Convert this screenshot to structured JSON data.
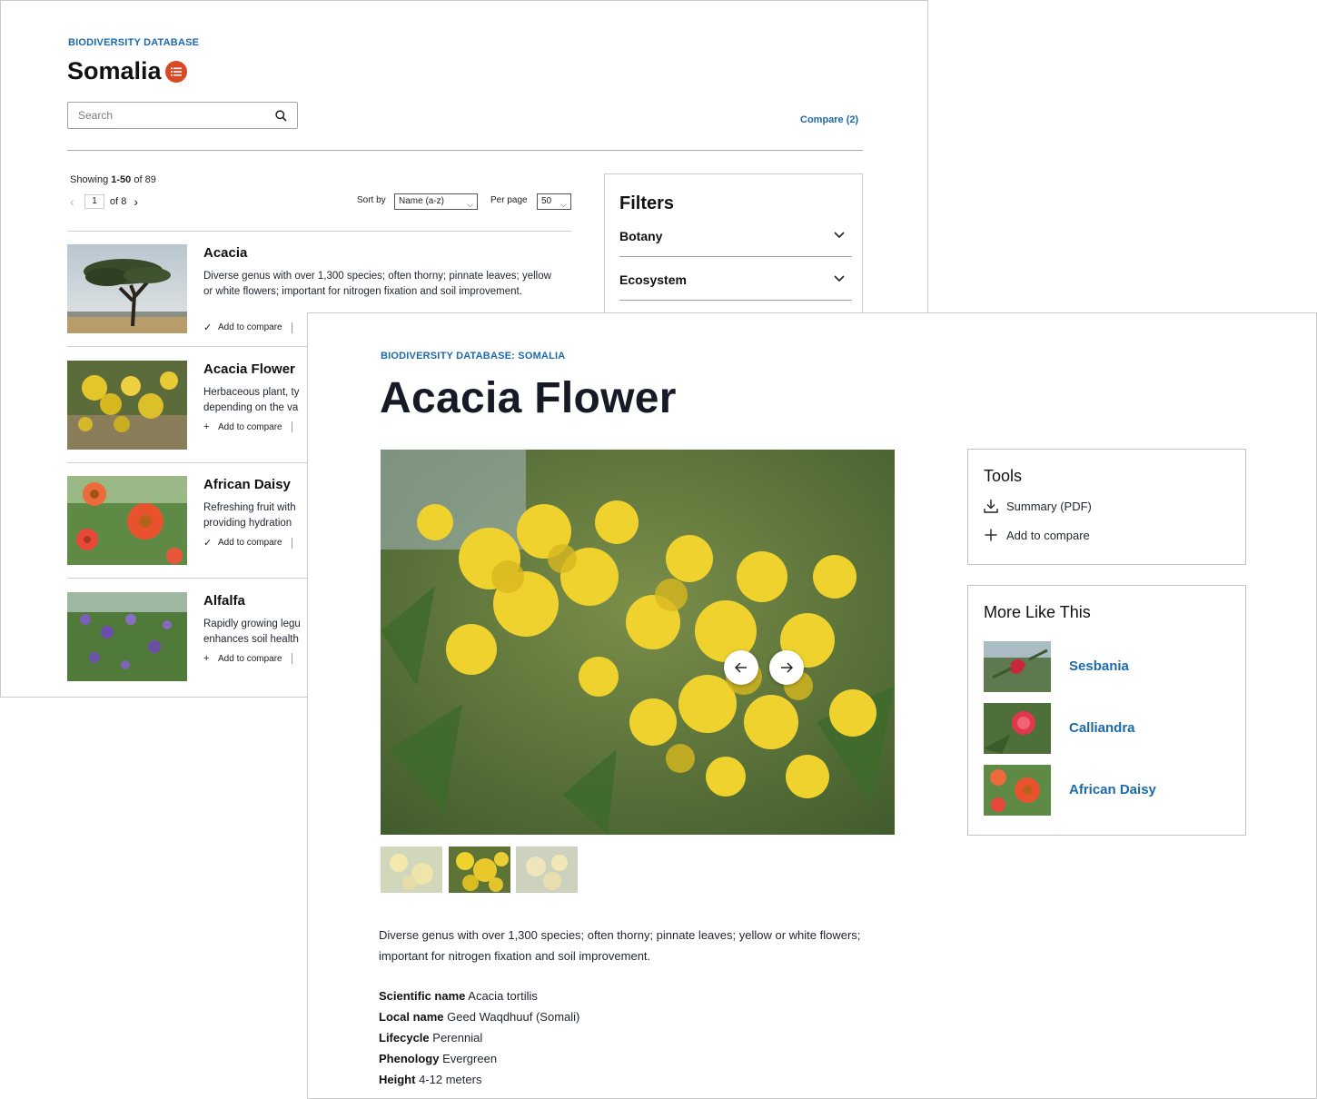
{
  "listing": {
    "eyebrow": "BIODIVERSITY DATABASE",
    "title": "Somalia",
    "search": {
      "placeholder": "Search"
    },
    "compare_link": "Compare (2)",
    "showing_prefix": "Showing ",
    "showing_range": "1-50",
    "showing_suffix": " of 89",
    "pager": {
      "page": "1",
      "of_label": "of 8"
    },
    "sort": {
      "label": "Sort by",
      "value": "Name (a-z)"
    },
    "per_page": {
      "label": "Per page",
      "value": "50"
    },
    "items": [
      {
        "name": "Acacia",
        "description": "Diverse genus with over 1,300 species; often thorny; pinnate leaves; yellow or white flowers; important for nitrogen fixation and soil improvement.",
        "compare_label": "Add to compare",
        "compare_mark": "✓"
      },
      {
        "name": "Acacia Flower",
        "description": "Herbaceous plant, ty depending on the va",
        "compare_label": "Add to compare",
        "compare_mark": "+"
      },
      {
        "name": "African Daisy",
        "description": "Refreshing fruit with providing hydration",
        "compare_label": "Add to compare",
        "compare_mark": "✓"
      },
      {
        "name": "Alfalfa",
        "description": "Rapidly growing legu enhances soil health",
        "compare_label": "Add to compare",
        "compare_mark": "+"
      }
    ],
    "filters": {
      "title": "Filters",
      "groups": [
        "Botany",
        "Ecosystem"
      ]
    }
  },
  "detail": {
    "eyebrow": "BIODIVERSITY DATABASE: SOMALIA",
    "title": "Acacia Flower",
    "description": "Diverse genus with over 1,300 species; often thorny; pinnate leaves; yellow or white flowers; important for nitrogen fixation and soil improvement.",
    "facts": [
      {
        "label": "Scientific name",
        "value": "Acacia tortilis"
      },
      {
        "label": "Local name",
        "value": "Geed Waqdhuuf (Somali)"
      },
      {
        "label": "Lifecycle",
        "value": "Perennial"
      },
      {
        "label": "Phenology",
        "value": "Evergreen"
      },
      {
        "label": "Height",
        "value": "4-12 meters"
      }
    ],
    "tools": {
      "title": "Tools",
      "summary_label": "Summary (PDF)",
      "compare_label": "Add to compare"
    },
    "more_like_this": {
      "title": "More Like This",
      "items": [
        "Sesbania",
        "Calliandra",
        "African Daisy"
      ]
    }
  },
  "icons": {
    "search": "search-icon",
    "list_badge": "list-icon",
    "chevron_down": "chevron-down-icon",
    "arrow_left": "arrow-left-icon",
    "arrow_right": "arrow-right-icon",
    "download": "download-icon",
    "plus": "plus-icon",
    "check": "check-icon"
  },
  "colors": {
    "accent_blue": "#1c6aa8",
    "badge_orange": "#d84a25",
    "text_dark": "#151a24",
    "border_gray": "#c9cbd1"
  }
}
